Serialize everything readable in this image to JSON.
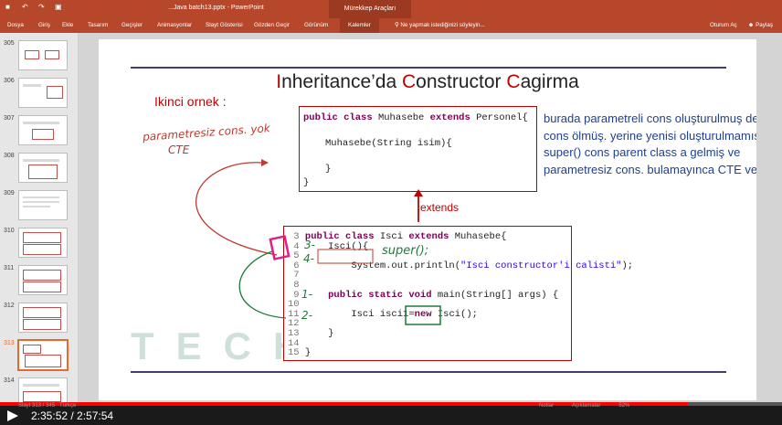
{
  "app": {
    "quick_access": [
      "save-icon",
      "undo-icon",
      "redo-icon",
      "slideshow-icon"
    ],
    "doc_title": "...Java batch13.pptx - PowerPoint",
    "context_tab": "Mürekkep Araçları"
  },
  "ribbon": {
    "tabs": [
      "Dosya",
      "Giriş",
      "Ekle",
      "Tasarım",
      "Geçişler",
      "Animasyonlar",
      "Slayt Gösterisi",
      "Gözden Geçir",
      "Görünüm"
    ],
    "active_tab": "Kalemler",
    "tell_me": "Ne yapmak istediğinizi söyleyin...",
    "right": [
      "Oturum Aç",
      "Paylaş"
    ]
  },
  "thumbnails": [
    {
      "num": "305"
    },
    {
      "num": "306"
    },
    {
      "num": "307"
    },
    {
      "num": "308"
    },
    {
      "num": "309"
    },
    {
      "num": "310"
    },
    {
      "num": "311"
    },
    {
      "num": "312"
    },
    {
      "num": "313",
      "selected": true
    },
    {
      "num": "314"
    }
  ],
  "slide": {
    "title_parts": [
      {
        "t": "I",
        "red": true
      },
      {
        "t": "nheritance’da ",
        "red": false
      },
      {
        "t": "C",
        "red": true
      },
      {
        "t": "onstructor ",
        "red": false
      },
      {
        "t": "C",
        "red": true
      },
      {
        "t": "agirma",
        "red": false
      }
    ],
    "subtitle": "Ikinci ornek :",
    "code_top": {
      "l1_kw1": "public",
      "l1_kw2": "class",
      "l1_name": " Muhasebe ",
      "l1_kw3": "extends",
      "l1_rest": " Personel{",
      "l2": "Muhasebe(String isim){",
      "l3": "}",
      "l4": "}"
    },
    "extends_label": "extends",
    "code_bottom": {
      "lines": [
        {
          "n": "3",
          "segs": [
            {
              "k": true,
              "t": "public class"
            },
            {
              "t": " Isci "
            },
            {
              "k": true,
              "t": "extends"
            },
            {
              "t": " Muhasebe{"
            }
          ]
        },
        {
          "n": "4",
          "segs": [
            {
              "t": "    Isci(){"
            }
          ]
        },
        {
          "n": "5",
          "segs": []
        },
        {
          "n": "6",
          "segs": [
            {
              "t": "        System."
            },
            {
              "t": "out"
            },
            {
              "t": ".println("
            },
            {
              "s": true,
              "t": "\"Isci constructor'i calisti\""
            },
            {
              "t": ");"
            }
          ]
        },
        {
          "n": "7",
          "segs": []
        },
        {
          "n": "8",
          "segs": []
        },
        {
          "n": "9",
          "segs": [
            {
              "t": "    "
            },
            {
              "k": true,
              "t": "public static void"
            },
            {
              "t": " main(String[] args) {"
            }
          ]
        },
        {
          "n": "10",
          "segs": []
        },
        {
          "n": "11",
          "segs": [
            {
              "t": "        Isci isci1="
            },
            {
              "k": true,
              "t": "new"
            },
            {
              "t": " Isci();"
            }
          ]
        },
        {
          "n": "12",
          "segs": []
        },
        {
          "n": "13",
          "segs": [
            {
              "t": "    }"
            }
          ]
        },
        {
          "n": "14",
          "segs": []
        },
        {
          "n": "15",
          "segs": [
            {
              "t": "}"
            }
          ]
        }
      ]
    },
    "note": "burada parametreli cons oluşturulmuş default cons ölmüş. yerine yenisi oluşturulmamış. super() cons parent class a gelmiş ve parametresiz cons. bulamayınca CTE vermiş.",
    "handwriting": {
      "red_note_line1": "parametresiz cons. yok",
      "red_note_line2": "CTE",
      "super_call": "super();",
      "step1": "1-",
      "step2": "2-",
      "step3": "3-",
      "step4": "4-"
    },
    "watermark": "TECHPROED"
  },
  "statusbar": {
    "time": "2:35:52 / 2:57:54",
    "slide_info": "Slayt 313 / 345",
    "lang": "Türkçe",
    "notes": "Notlar",
    "comments": "Açıklamalar",
    "zoom": "52%",
    "progress": 0.88
  },
  "colors": {
    "ppt_red": "#b7472a",
    "slide_red": "#c00000",
    "note_blue": "#1f3f8f",
    "ink_green": "#1f7a3a",
    "ink_magenta": "#e0208a",
    "progress_red": "#ff0000"
  }
}
